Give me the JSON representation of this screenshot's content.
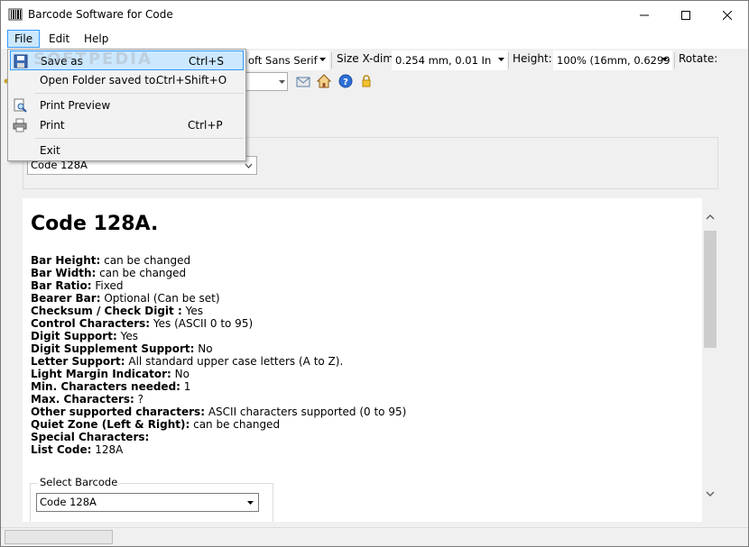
{
  "window": {
    "title": "Barcode Software for Code",
    "icon": "barcode-app-icon"
  },
  "menu": {
    "items": [
      "File",
      "Edit",
      "Help"
    ]
  },
  "file_menu": {
    "save_as": {
      "label": "Save as",
      "shortcut": "Ctrl+S"
    },
    "open_folder": {
      "label": "Open Folder saved to.",
      "shortcut": "Ctrl+Shift+O"
    },
    "print_preview": {
      "label": "Print Preview"
    },
    "print": {
      "label": "Print",
      "shortcut": "Ctrl+P"
    },
    "exit": {
      "label": "Exit"
    }
  },
  "watermark": "SOFTPEDIA",
  "toolbar": {
    "font_value": "oft Sans Serif",
    "size_label": "Size X-dim",
    "size_value": "0.254 mm, 0.01 In",
    "height_label": "Height:",
    "height_value": "100% (16mm, 0.6299",
    "rotate_label": "Rotate:"
  },
  "barcode_select_top": "Code 128A",
  "content": {
    "heading": "Code 128A.",
    "properties": [
      {
        "name": "Bar Height:",
        "value": " can be changed"
      },
      {
        "name": "Bar Width:",
        "value": " can be changed"
      },
      {
        "name": "Bar Ratio:",
        "value": " Fixed"
      },
      {
        "name": "Bearer Bar:",
        "value": " Optional (Can be set)"
      },
      {
        "name": "Checksum / Check Digit :",
        "value": " Yes"
      },
      {
        "name": "Control Characters:",
        "value": " Yes (ASCII 0 to 95)"
      },
      {
        "name": "Digit Support:",
        "value": " Yes"
      },
      {
        "name": "Digit Supplement Support:",
        "value": " No"
      },
      {
        "name": "Letter Support:",
        "value": " All standard upper case letters (A to Z)."
      },
      {
        "name": "Light Margin Indicator:",
        "value": " No"
      },
      {
        "name": "Min. Characters needed:",
        "value": " 1"
      },
      {
        "name": "Max. Characters:",
        "value": " ?"
      },
      {
        "name": "Other supported characters:",
        "value": " ASCII characters supported (0 to 95)"
      },
      {
        "name": "Quiet Zone (Left & Right):",
        "value": " can be changed"
      },
      {
        "name": "Special Characters:",
        "value": ""
      },
      {
        "name": "List Code:",
        "value": " 128A"
      }
    ],
    "select_barcode_legend": "Select Barcode",
    "select_barcode_value": "Code 128A"
  },
  "colors": {
    "menu_highlight": "#cce8ff",
    "menu_highlight_border": "#3399ff"
  }
}
